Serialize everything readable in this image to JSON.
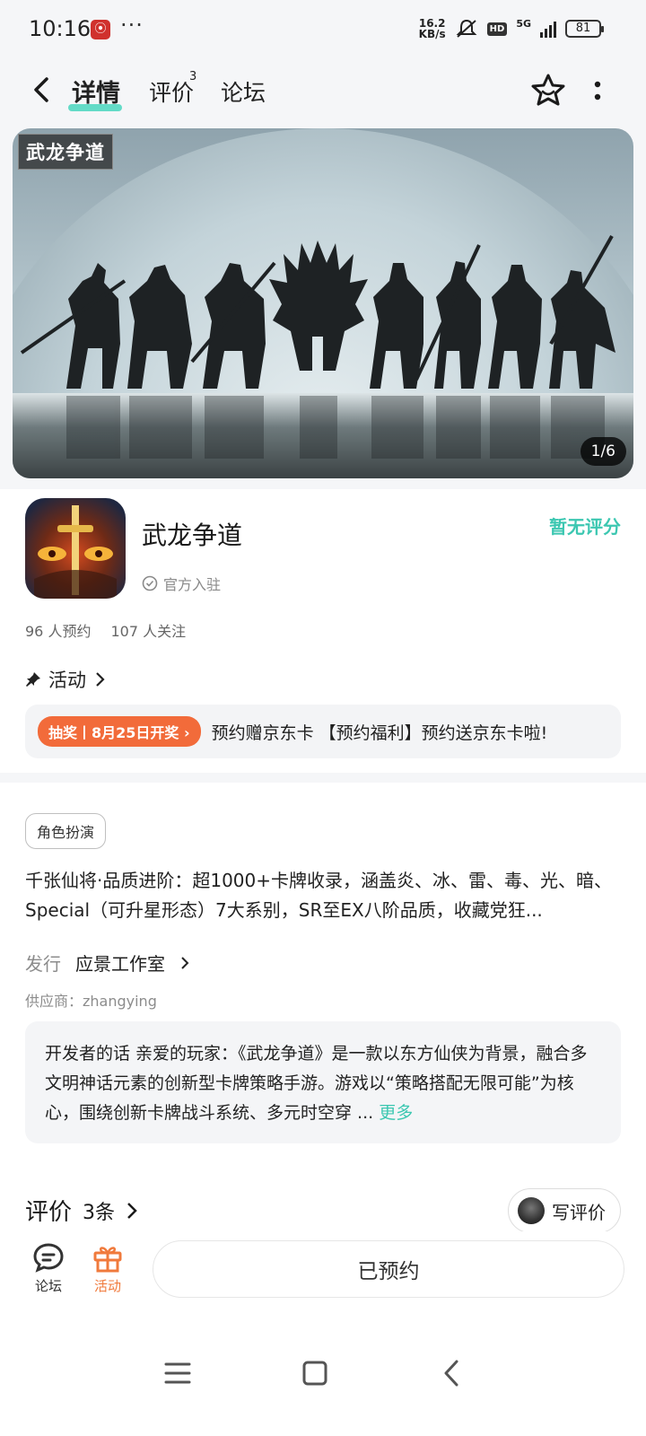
{
  "status_bar": {
    "time": "10:16",
    "dots": "···",
    "net_speed_value": "16.2",
    "net_speed_unit": "KB/s",
    "hd": "HD",
    "network": "5G",
    "battery": "81"
  },
  "nav": {
    "tabs": [
      {
        "label": "详情",
        "active": true
      },
      {
        "label": "评价",
        "badge": "3"
      },
      {
        "label": "论坛"
      }
    ],
    "accent_color": "#49d6be"
  },
  "banner": {
    "logo_text": "武龙争道",
    "page_indicator": "1/6"
  },
  "app": {
    "name": "武龙争道",
    "official_label": "官方入驻",
    "rating_text": "暂无评分",
    "reservations": "96 人预约",
    "followers": "107 人关注",
    "activity_label": "活动",
    "promo_tag": "抽奖丨8月25日开奖",
    "promo_text": "预约赠京东卡 【预约福利】预约送京东卡啦!"
  },
  "details": {
    "genre": "角色扮演",
    "description": "千张仙将·品质进阶：超1000+卡牌收录，涵盖炎、冰、雷、毒、光、暗、Special（可升星形态）7大系别，SR至EX八阶品质，收藏党狂...",
    "publisher_label": "发行",
    "publisher_name": "应景工作室",
    "supplier": "供应商：zhangying",
    "developer_note": "开发者的话  亲爱的玩家：《武龙争道》是一款以东方仙侠为背景，融合多文明神话元素的创新型卡牌策略手游。游戏以“策略搭配无限可能”为核心，围绕创新卡牌战斗系统、多元时空穿 ...",
    "more_label": "更多"
  },
  "reviews": {
    "title": "评价",
    "count": "3条",
    "write_label": "写评价"
  },
  "bottom_bar": {
    "forum_label": "论坛",
    "activity_label": "活动",
    "reserve_label": "已预约"
  },
  "colors": {
    "accent": "#3cc7b1",
    "promo": "#f26b3a",
    "activity": "#f07a3c"
  }
}
